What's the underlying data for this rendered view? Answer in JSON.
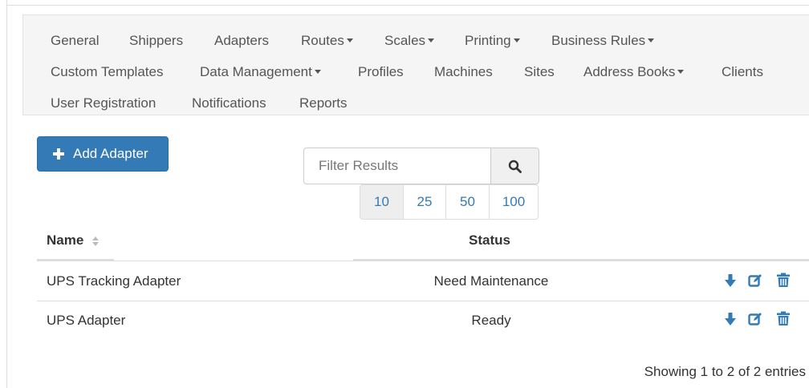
{
  "nav": {
    "row1": [
      {
        "label": "General",
        "dropdown": false
      },
      {
        "label": "Shippers",
        "dropdown": false
      },
      {
        "label": "Adapters",
        "dropdown": false
      },
      {
        "label": "Routes",
        "dropdown": true
      },
      {
        "label": "Scales",
        "dropdown": true
      },
      {
        "label": "Printing",
        "dropdown": true
      },
      {
        "label": "Business Rules",
        "dropdown": true
      }
    ],
    "row2": [
      {
        "label": "Custom Templates",
        "dropdown": false
      },
      {
        "label": "Data Management",
        "dropdown": true
      },
      {
        "label": "Profiles",
        "dropdown": false
      },
      {
        "label": "Machines",
        "dropdown": false
      },
      {
        "label": "Sites",
        "dropdown": false
      },
      {
        "label": "Address Books",
        "dropdown": true
      },
      {
        "label": "Clients",
        "dropdown": false
      }
    ],
    "row3": [
      {
        "label": "User Registration",
        "dropdown": false
      },
      {
        "label": "Notifications",
        "dropdown": false
      },
      {
        "label": "Reports",
        "dropdown": false
      }
    ]
  },
  "toolbar": {
    "add_label": "Add Adapter",
    "add_icon": "plus-icon"
  },
  "filter": {
    "placeholder": "Filter Results",
    "value": "",
    "search_icon": "search-icon"
  },
  "page_sizes": {
    "options": [
      "10",
      "25",
      "50",
      "100"
    ],
    "selected": "10"
  },
  "table": {
    "columns": [
      "Name",
      "Status"
    ],
    "sort_icon": "sort-icon",
    "rows": [
      {
        "name": "UPS Tracking Adapter",
        "status": "Need Maintenance"
      },
      {
        "name": "UPS Adapter",
        "status": "Ready"
      }
    ],
    "actions": [
      "download-icon",
      "edit-icon",
      "trash-icon"
    ]
  },
  "footer": {
    "entries_text": "Showing 1 to 2 of 2 entries"
  },
  "colors": {
    "primary": "#337ab7",
    "nav_bg": "#f5f5f5",
    "border": "#dddddd"
  }
}
